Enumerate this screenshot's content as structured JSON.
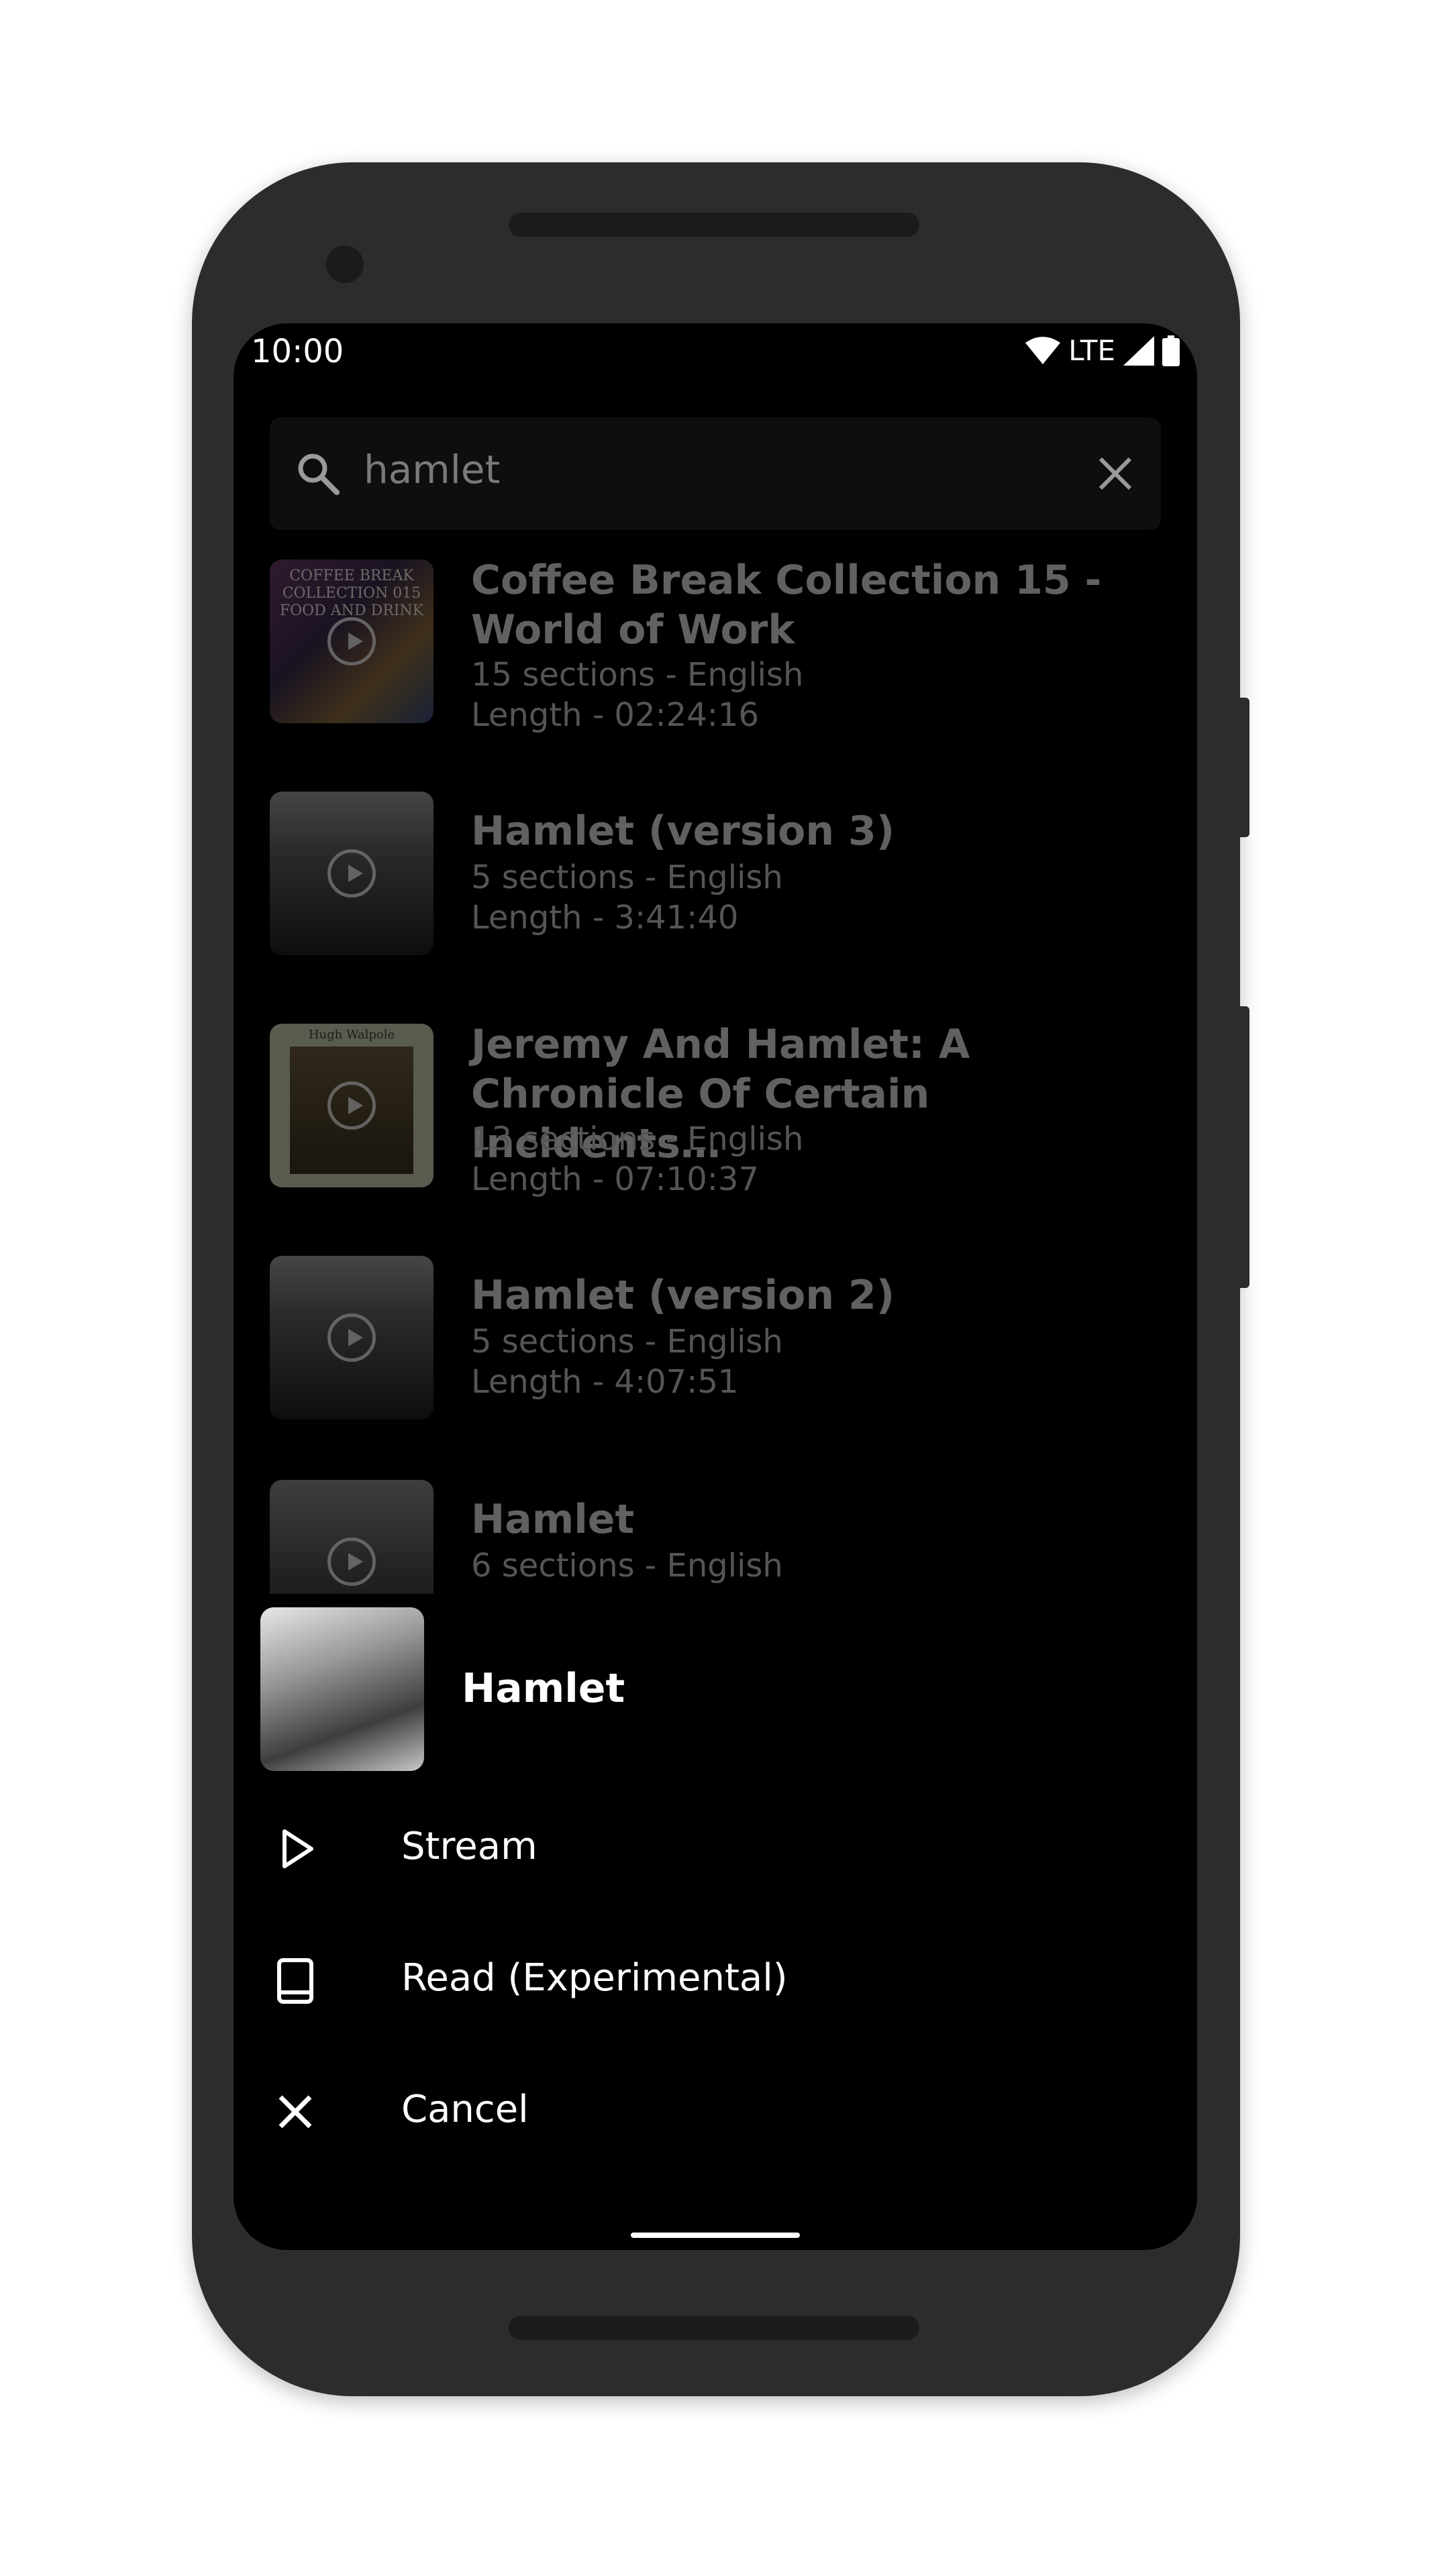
{
  "status_bar": {
    "time": "10:00",
    "network": "LTE"
  },
  "search": {
    "query": "hamlet"
  },
  "results": [
    {
      "title_line1": "Coffee Break Collection 15 -",
      "title_line2": "World of Work",
      "sections": "15 sections - English",
      "length": "Length - 02:24:16",
      "thumb_text": "COFFEE BREAK COLLECTION 015 FOOD AND DRINK"
    },
    {
      "title_line1": "Hamlet (version 3)",
      "title_line2": "",
      "sections": "5 sections - English",
      "length": "Length - 3:41:40"
    },
    {
      "title_line1": "Jeremy And Hamlet: A",
      "title_line2": "Chronicle Of Certain Incidents…",
      "sections": "13 sections - English",
      "length": "Length - 07:10:37",
      "thumb_text": "Hugh Walpole"
    },
    {
      "title_line1": "Hamlet (version 2)",
      "title_line2": "",
      "sections": "5 sections - English",
      "length": "Length - 4:07:51"
    },
    {
      "title_line1": "Hamlet",
      "title_line2": "",
      "sections": "6 sections - English",
      "length": ""
    }
  ],
  "sheet": {
    "title": "Hamlet",
    "options": [
      {
        "label": "Stream",
        "icon": "play-outline-icon"
      },
      {
        "label": "Read (Experimental)",
        "icon": "book-icon"
      },
      {
        "label": "Cancel",
        "icon": "close-icon"
      }
    ]
  }
}
